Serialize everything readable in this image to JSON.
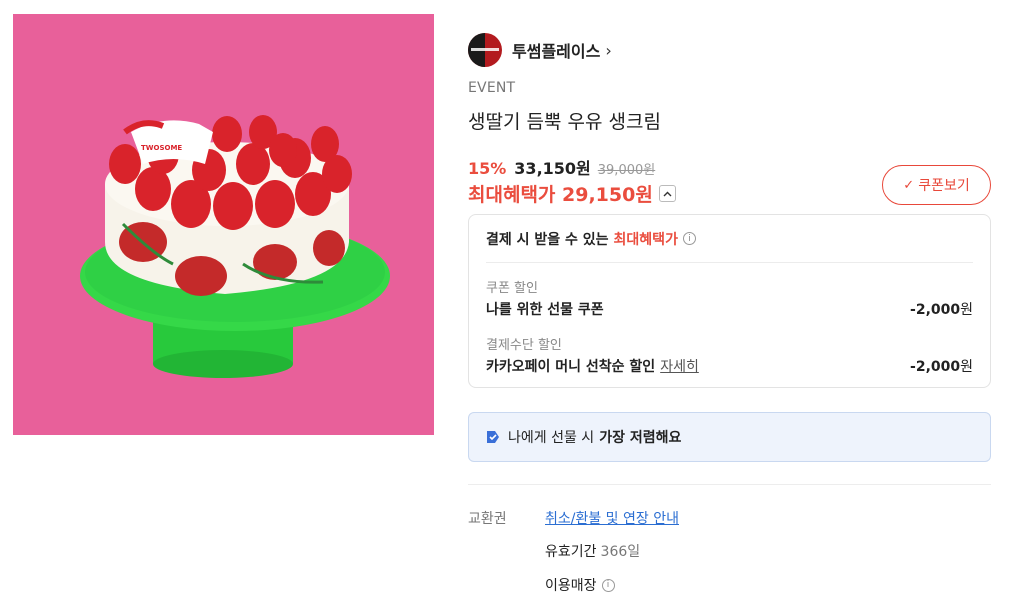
{
  "brand": {
    "name": "투썸플레이스",
    "chevron": "›"
  },
  "product": {
    "event_label": "EVENT",
    "title": "생딸기 듬뿍 우유 생크림",
    "discount_rate": "15%",
    "price": "33,150원",
    "original_price": "39,000원",
    "max_benefit": "최대혜택가 29,150원",
    "image_logo_text": "TWOSOME"
  },
  "coupon_button": {
    "icon": "✓",
    "label": "쿠폰보기"
  },
  "benefits": {
    "heading": "결제 시 받을 수 있는",
    "heading_accent": "최대혜택가",
    "items": [
      {
        "category": "쿠폰 할인",
        "name": "나를 위한 선물 쿠폰",
        "amount": "-2,000",
        "unit": "원"
      },
      {
        "category": "결제수단 할인",
        "name": "카카오페이 머니 선착순 할인",
        "link": "자세히",
        "amount": "-2,000",
        "unit": "원"
      }
    ]
  },
  "gift_notice": {
    "text": "나에게 선물 시",
    "bold": "가장 저렴해요"
  },
  "voucher": {
    "label": "교환권",
    "policy_link": "취소/환불 및 연장 안내",
    "validity_label": "유효기간",
    "validity_value": "366일",
    "stores_label": "이용매장"
  },
  "colors": {
    "accent_red": "#ea4d3e",
    "link_blue": "#2b6ed2",
    "image_bg": "#e8609a",
    "gift_bg": "#eef3fc"
  },
  "icons": {
    "info": "info-icon",
    "expand": "chevron-up-icon",
    "gift": "gift-tag-icon"
  }
}
